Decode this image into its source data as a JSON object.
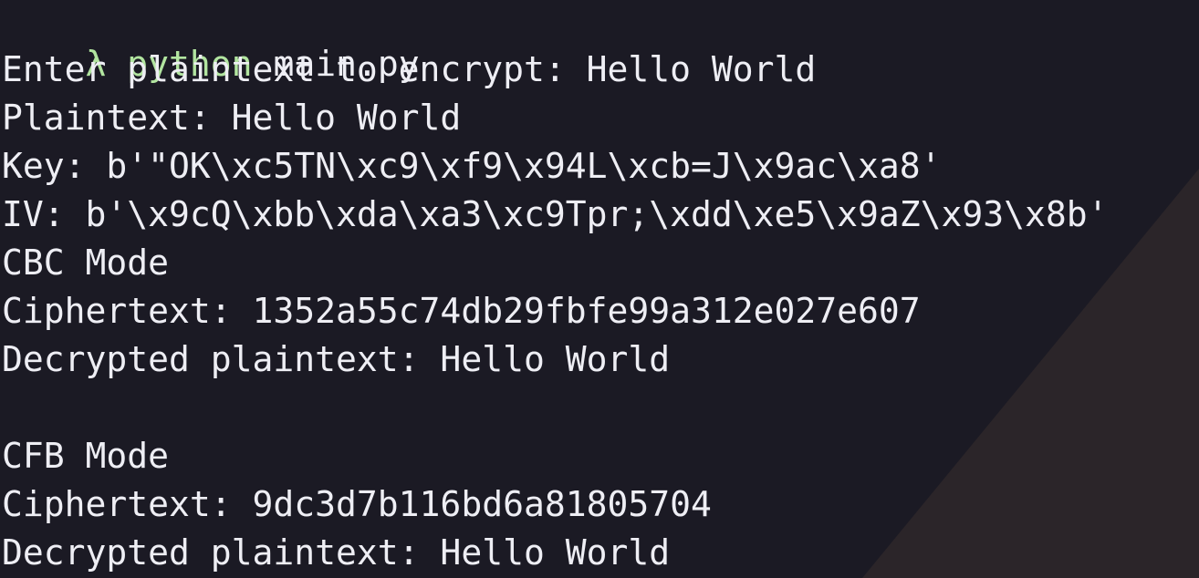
{
  "colors": {
    "background": "#1b1a24",
    "background_accent": "#2b2529",
    "text": "#eeeef4",
    "prompt": "#b2e5a0"
  },
  "prompt": {
    "symbol": "λ",
    "command": "python",
    "argument": "main.py"
  },
  "output": {
    "input_line": "Enter plaintext to encrypt: Hello World",
    "plaintext_line": "Plaintext: Hello World",
    "key_line": "Key: b'\"OK\\xc5TN\\xc9\\xf9\\x94L\\xcb=J\\x9ac\\xa8'",
    "iv_line": "IV: b'\\x9cQ\\xbb\\xda\\xa3\\xc9Tpr;\\xdd\\xe5\\x9aZ\\x93\\x8b'",
    "cbc": {
      "title": "CBC Mode",
      "ciphertext": "Ciphertext: 1352a55c74db29fbfe99a312e027e607",
      "decrypted": "Decrypted plaintext: Hello World"
    },
    "blank_line": "",
    "cfb": {
      "title": "CFB Mode",
      "ciphertext": "Ciphertext: 9dc3d7b116bd6a81805704",
      "decrypted": "Decrypted plaintext: Hello World"
    }
  }
}
